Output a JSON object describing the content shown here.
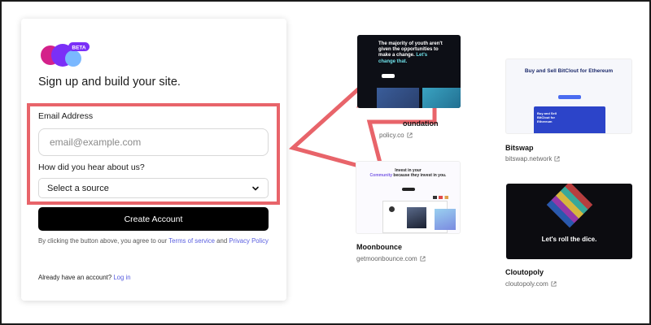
{
  "signup": {
    "logo_badge": "BETA",
    "headline": "Sign up and build your site.",
    "email_label": "Email Address",
    "email_placeholder": "email@example.com",
    "source_label": "How did you hear about us?",
    "source_selected": "Select a source",
    "create_button": "Create Account",
    "terms_prefix": "By clicking the button above, you agree to our",
    "terms_link": "Terms of service",
    "terms_and": "and",
    "privacy_link": "Privacy Policy",
    "login_prompt": "Already have an account?",
    "login_link": "Log in"
  },
  "colors": {
    "accent_link": "#5a5fe0",
    "highlight": "#e8646a",
    "button": "#000000",
    "logo_pink": "#d4218a",
    "logo_purple": "#7b2ff7",
    "logo_blue": "#7ab8ff"
  },
  "showcase": [
    {
      "name": "Foundation",
      "visible_name": "oundation",
      "url": "policy.co",
      "thumb_text": "The majority of youth aren't given the opportunities to make a change.",
      "thumb_highlight": "Let's change that."
    },
    {
      "name": "Bitswap",
      "url": "bitswap.network",
      "thumb_text": "Buy and Sell BitClout for Ethereum",
      "thumb_sub": "Buy and Sell BitClout for Ethereum"
    },
    {
      "name": "Moonbounce",
      "url": "getmoonbounce.com",
      "thumb_text_1": "Invest in your",
      "thumb_highlight": "Community",
      "thumb_text_2": "because they invest in you."
    },
    {
      "name": "Cloutopoly",
      "url": "cloutopoly.com",
      "thumb_text": "Let's roll the dice."
    }
  ]
}
